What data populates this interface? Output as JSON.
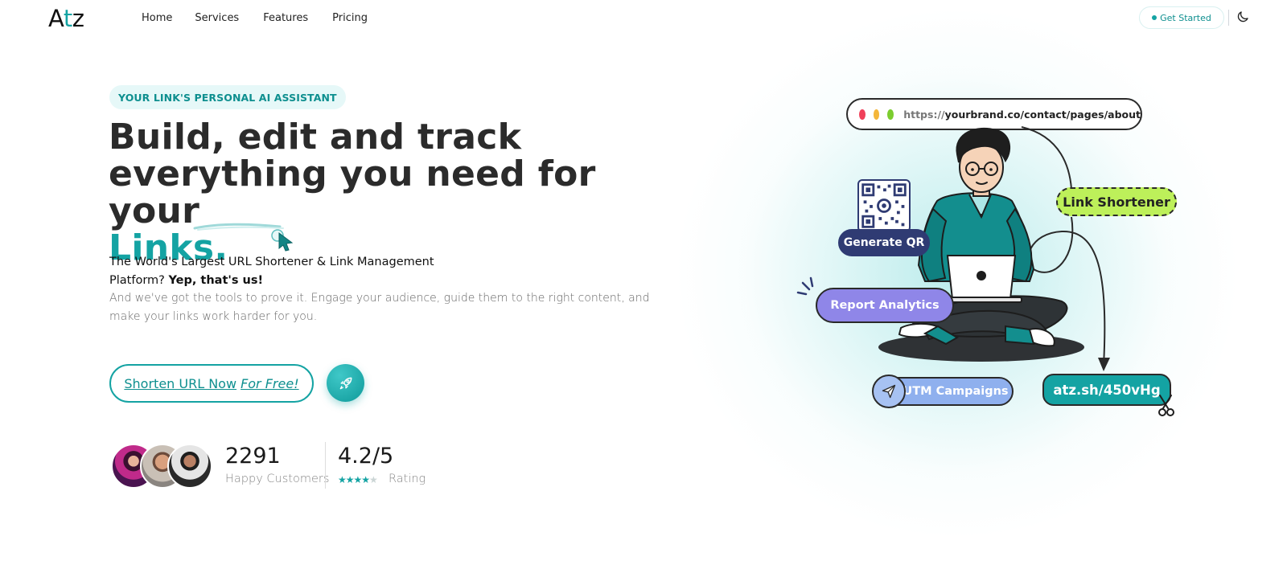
{
  "nav": {
    "logo": {
      "a": "A",
      "t": "t",
      "z": "z"
    },
    "links": [
      "Home",
      "Services",
      "Features",
      "Pricing"
    ],
    "cta_label": "Get Started",
    "theme_icon": "moon-icon"
  },
  "hero": {
    "badge": "YOUR LINK'S PERSONAL AI ASSISTANT",
    "headline_line1": "Build, edit and track",
    "headline_line2": "everything you need for your",
    "headline_accent": "Links.",
    "sub_plain": "The World's Largest URL Shortener & Link Management Platform?",
    "sub_bold": "Yep, that's us!",
    "description": "And we've got the tools to prove it. Engage your audience, guide them to the right content, and make your links work harder for you.",
    "cta_main": "Shorten URL Now",
    "cta_italic": "For Free!",
    "rocket_icon": "rocket-icon"
  },
  "stats": {
    "customers_count": "2291",
    "customers_label": "Happy Customers",
    "rating_value": "4.2/5",
    "rating_label": "Rating",
    "rating_stars": 4.2
  },
  "illustration": {
    "url_proto": "https://",
    "url_rest": "yourbrand.co/contact/pages/about",
    "link_shortener": "Link Shortener",
    "generate_qr": "Generate QR",
    "report_analytics": "Report Analytics",
    "utm_campaigns": "UTM Campaigns",
    "short_url": "atz.sh/450vHg"
  },
  "colors": {
    "accent": "#14a3a3",
    "lime": "#bdf05a",
    "navy": "#2f3b73",
    "lavender": "#8f86e8",
    "sky": "#8fb0ee",
    "dot_red": "#f0405a",
    "dot_yellow": "#f4b63a",
    "dot_green": "#7ccd2f"
  }
}
